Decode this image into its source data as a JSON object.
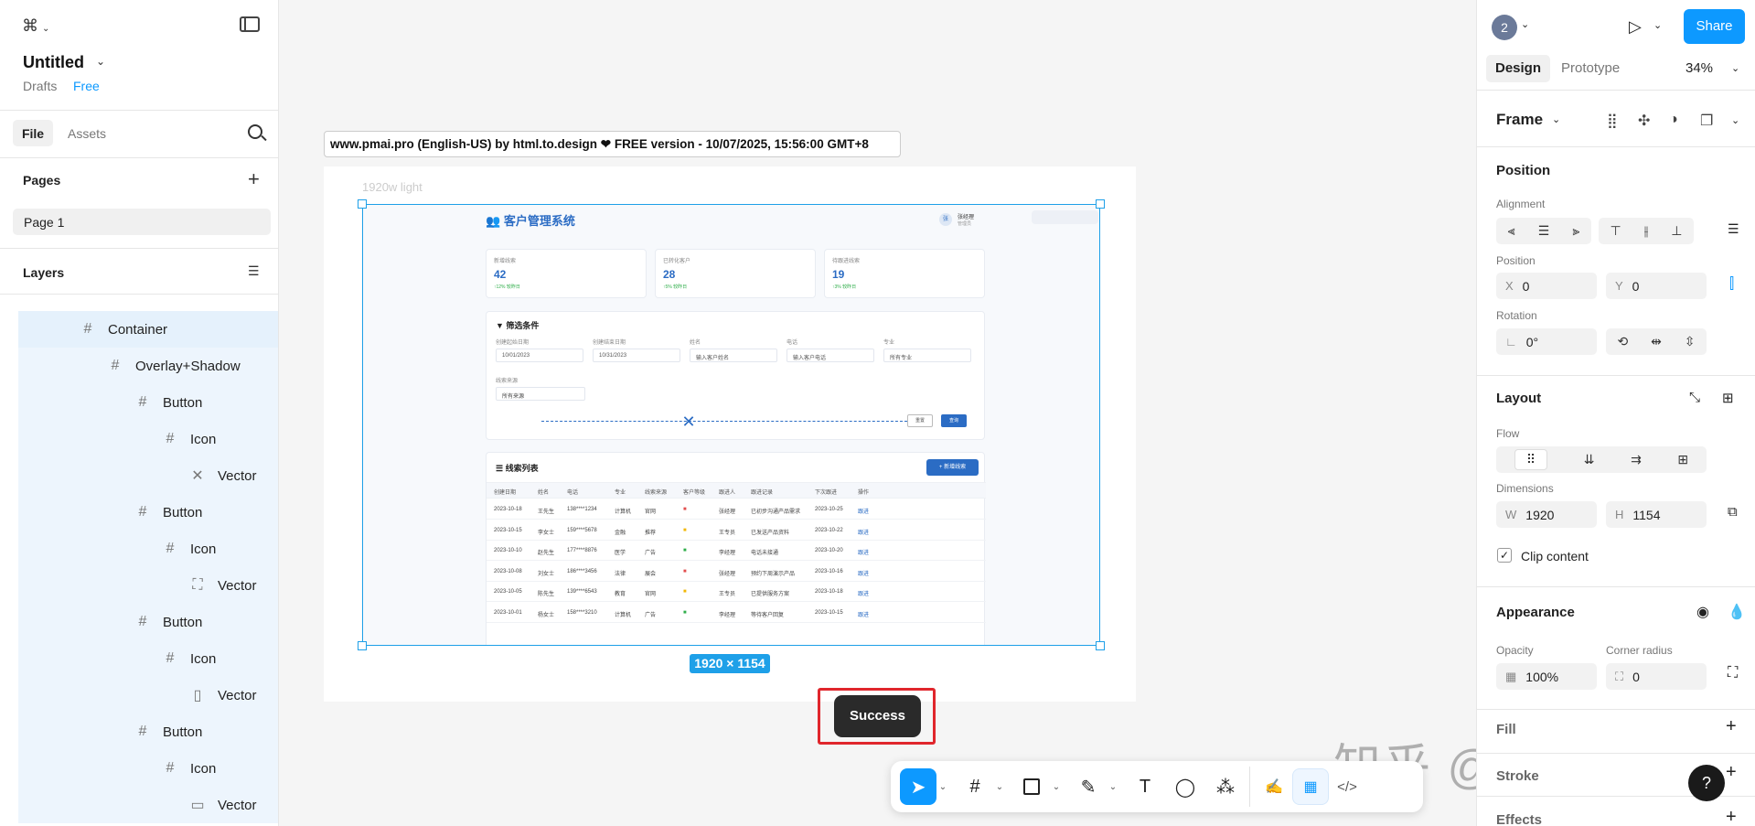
{
  "left_panel": {
    "title": "Untitled",
    "drafts": "Drafts",
    "plan": "Free",
    "tabs": [
      "File",
      "Assets"
    ],
    "pages_label": "Pages",
    "pages": [
      "Page 1"
    ],
    "layers_label": "Layers",
    "layers": [
      {
        "name": "Container",
        "icon": "hash-icon",
        "depth": 0
      },
      {
        "name": "Overlay+Shadow",
        "icon": "hash-icon",
        "depth": 1
      },
      {
        "name": "Button",
        "icon": "hash-icon",
        "depth": 2
      },
      {
        "name": "Icon",
        "icon": "hash-icon",
        "depth": 3
      },
      {
        "name": "Vector",
        "icon": "x-vector-icon",
        "depth": 4
      },
      {
        "name": "Button",
        "icon": "hash-icon",
        "depth": 2
      },
      {
        "name": "Icon",
        "icon": "hash-icon",
        "depth": 3
      },
      {
        "name": "Vector",
        "icon": "expand-vector-icon",
        "depth": 4
      },
      {
        "name": "Button",
        "icon": "hash-icon",
        "depth": 2
      },
      {
        "name": "Icon",
        "icon": "hash-icon",
        "depth": 3
      },
      {
        "name": "Vector",
        "icon": "device-vector-icon",
        "depth": 4
      },
      {
        "name": "Button",
        "icon": "hash-icon",
        "depth": 2
      },
      {
        "name": "Icon",
        "icon": "hash-icon",
        "depth": 3
      },
      {
        "name": "Vector",
        "icon": "monitor-vector-icon",
        "depth": 4
      }
    ]
  },
  "canvas": {
    "banner": "www.pmai.pro (English-US) by html.to.design ❤ FREE version - 10/07/2025, 15:56:00 GMT+8",
    "frame_name": "1920w light",
    "size_badge": "1920 × 1154",
    "toast": "Success",
    "watermark": "知乎 @产品手记",
    "mock": {
      "app_title": "客户管理系统",
      "user_name": "张经理",
      "user_role": "管理员",
      "stats": [
        {
          "label": "新增线索",
          "value": "42",
          "trend": "↑12% 较昨日"
        },
        {
          "label": "已转化客户",
          "value": "28",
          "trend": "↑5% 较昨日"
        },
        {
          "label": "待跟进线索",
          "value": "19",
          "trend": "↑3% 较昨日"
        }
      ],
      "filter_title": "筛选条件",
      "filters": [
        {
          "label": "创建起始日期",
          "value": "10/01/2023"
        },
        {
          "label": "创建结束日期",
          "value": "10/31/2023"
        },
        {
          "label": "姓名",
          "value": "输入客户姓名"
        },
        {
          "label": "电话",
          "value": "输入客户电话"
        },
        {
          "label": "专业",
          "value": "所有专业"
        }
      ],
      "source_label": "线索来源",
      "source_value": "所有来源",
      "reset_btn": "重置",
      "query_btn": "查询",
      "list_title": "线索列表",
      "add_btn": "+ 新增线索",
      "columns": [
        "创建日期",
        "姓名",
        "电话",
        "专业",
        "线索来源",
        "客户等级",
        "跟进人",
        "跟进记录",
        "下次跟进",
        "操作"
      ],
      "rows": [
        [
          "2023-10-18",
          "王先生",
          "138****1234",
          "计算机",
          "官网",
          "■",
          "张经理",
          "已初步沟通产品需求",
          "2023-10-25",
          "跟进"
        ],
        [
          "2023-10-15",
          "李女士",
          "159****5678",
          "金融",
          "推荐",
          "■",
          "王专员",
          "已发送产品资料",
          "2023-10-22",
          "跟进"
        ],
        [
          "2023-10-10",
          "赵先生",
          "177****8876",
          "医学",
          "广告",
          "■",
          "李经理",
          "电话未接通",
          "2023-10-20",
          "跟进"
        ],
        [
          "2023-10-08",
          "刘女士",
          "186****3456",
          "法律",
          "展会",
          "■",
          "张经理",
          "预约下周演示产品",
          "2023-10-16",
          "跟进"
        ],
        [
          "2023-10-05",
          "陈先生",
          "139****6543",
          "教育",
          "官网",
          "■",
          "王专员",
          "已提供服务方案",
          "2023-10-18",
          "跟进"
        ],
        [
          "2023-10-01",
          "杨女士",
          "158****3210",
          "计算机",
          "广告",
          "■",
          "李经理",
          "等待客户回复",
          "2023-10-15",
          "跟进"
        ]
      ],
      "level_colors": [
        "#e24c4c",
        "#f2b705",
        "#2fae4a",
        "#e24c4c",
        "#f2b705",
        "#2fae4a"
      ],
      "accent": "#2b6cc4"
    }
  },
  "right_panel": {
    "avatar": "2",
    "share": "Share",
    "tabs": [
      "Design",
      "Prototype"
    ],
    "zoom": "34%",
    "frame_label": "Frame",
    "position_title": "Position",
    "alignment_label": "Alignment",
    "position_label": "Position",
    "x_label": "X",
    "x_value": "0",
    "y_label": "Y",
    "y_value": "0",
    "rotation_label": "Rotation",
    "rotation_value": "0°",
    "layout_title": "Layout",
    "flow_label": "Flow",
    "dimensions_label": "Dimensions",
    "w_label": "W",
    "w_value": "1920",
    "h_label": "H",
    "h_value": "1154",
    "clip_label": "Clip content",
    "appearance_title": "Appearance",
    "opacity_label": "Opacity",
    "opacity_value": "100%",
    "radius_label": "Corner radius",
    "radius_value": "0",
    "fill_title": "Fill",
    "stroke_title": "Stroke",
    "effects_title": "Effects",
    "help": "?"
  },
  "colors": {
    "brand_blue": "#0d99ff",
    "selection": "#1ea0e8",
    "toast_border": "#e0262c"
  }
}
